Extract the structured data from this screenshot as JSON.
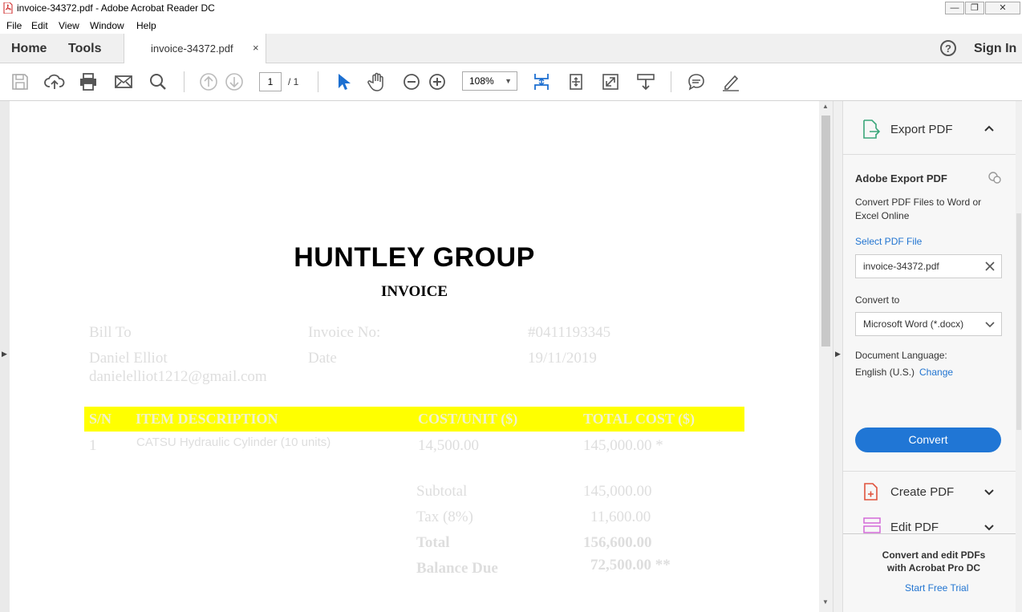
{
  "window": {
    "title": "invoice-34372.pdf - Adobe Acrobat Reader DC",
    "minimize": "—",
    "restore": "❐",
    "close": "✕"
  },
  "menu": [
    "File",
    "Edit",
    "View",
    "Window",
    "Help"
  ],
  "tabs": {
    "home": "Home",
    "tools": "Tools",
    "document": "invoice-34372.pdf",
    "close": "×",
    "help": "?",
    "sign_in": "Sign In"
  },
  "toolbar": {
    "page_current": "1",
    "page_total": "/ 1",
    "zoom": "108%",
    "zoom_caret": "▼"
  },
  "document": {
    "company": "HUNTLEY GROUP",
    "heading": "INVOICE",
    "bill_to_label": "Bill To",
    "customer_name": "Daniel Elliot",
    "customer_email": "danielelliot1212@gmail.com",
    "invoice_no_label": "Invoice No:",
    "invoice_no": "#0411193345",
    "date_label": "Date",
    "date": "19/11/2019",
    "table_headers": {
      "sn": "S/N",
      "description": "ITEM DESCRIPTION",
      "cost_unit": "COST/UNIT ($)",
      "total_cost": "TOTAL COST ($)"
    },
    "rows": [
      {
        "sn": "1",
        "description": "CATSU Hydraulic Cylinder (10 units)",
        "cost_unit": "14,500.00",
        "total_cost": "145,000.00 *"
      }
    ],
    "summary": {
      "subtotal_label": "Subtotal",
      "subtotal": "145,000.00",
      "tax_label": "Tax (8%)",
      "tax": "11,600.00",
      "total_label": "Total",
      "total": "156,600.00",
      "balance_label": "Balance Due",
      "balance": "72,500.00 **"
    }
  },
  "right_panel": {
    "export_title": "Export PDF",
    "service_title": "Adobe Export PDF",
    "description": "Convert PDF Files to Word or Excel Online",
    "select_file": "Select PDF File",
    "file_name": "invoice-34372.pdf",
    "convert_to_label": "Convert to",
    "convert_to_value": "Microsoft Word (*.docx)",
    "language_label": "Document Language:",
    "language_value": "English (U.S.)",
    "change": "Change",
    "convert_button": "Convert",
    "create_pdf": "Create PDF",
    "edit_pdf": "Edit PDF",
    "promo": "Convert and edit PDFs with Acrobat Pro DC",
    "trial": "Start Free Trial"
  },
  "colors": {
    "accent_blue": "#2076d5",
    "highlight_yellow": "#ffff00",
    "export_green": "#3aa67a",
    "create_red": "#e0533d",
    "edit_pink": "#d36ad8"
  }
}
